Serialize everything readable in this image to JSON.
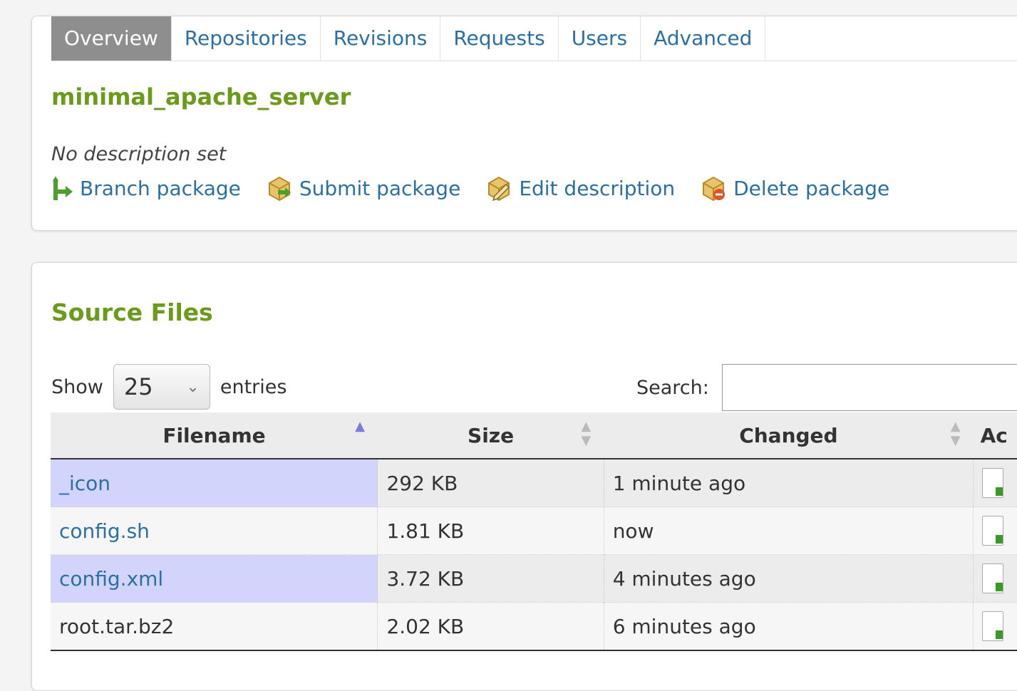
{
  "tabs": [
    "Overview",
    "Repositories",
    "Revisions",
    "Requests",
    "Users",
    "Advanced"
  ],
  "active_tab": "Overview",
  "package": {
    "name": "minimal_apache_server",
    "description": "No description set"
  },
  "actions": {
    "branch": "Branch package",
    "submit": "Submit package",
    "edit": "Edit description",
    "delete": "Delete package"
  },
  "source_files": {
    "title": "Source Files",
    "show_label": "Show",
    "entries_value": "25",
    "entries_label": "entries",
    "search_label": "Search:",
    "search_value": "",
    "columns": [
      "Filename",
      "Size",
      "Changed",
      "Ac"
    ],
    "rows": [
      {
        "filename": "_icon",
        "size": "292 KB",
        "changed": "1 minute ago"
      },
      {
        "filename": "config.sh",
        "size": "1.81 KB",
        "changed": "now"
      },
      {
        "filename": "config.xml",
        "size": "3.72 KB",
        "changed": "4 minutes ago"
      },
      {
        "filename": "root.tar.bz2",
        "size": "2.02 KB",
        "changed": "6 minutes ago"
      }
    ]
  },
  "colors": {
    "link": "#2a6fa8",
    "title_green": "#6a9b1a",
    "active_tab_bg": "#8e8e8e",
    "sorted_column": "#d2d4fb"
  }
}
